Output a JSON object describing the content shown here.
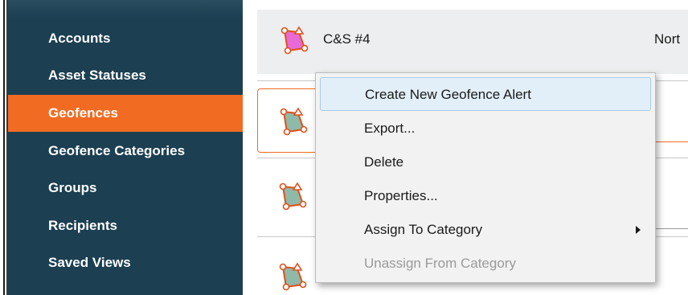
{
  "sidebar": {
    "items": [
      {
        "label": "Accounts",
        "active": false
      },
      {
        "label": "Asset Statuses",
        "active": false
      },
      {
        "label": "Geofences",
        "active": true
      },
      {
        "label": "Geofence Categories",
        "active": false
      },
      {
        "label": "Groups",
        "active": false
      },
      {
        "label": "Recipients",
        "active": false
      },
      {
        "label": "Saved Views",
        "active": false
      }
    ]
  },
  "list": {
    "top_row": {
      "name": "C&S #4",
      "region": "Nort",
      "icon": "geofence-polygon-pink-icon"
    },
    "rows": [
      {
        "icon": "geofence-polygon-green-icon",
        "selected": true
      },
      {
        "icon": "geofence-polygon-green-icon",
        "selected": false
      },
      {
        "icon": "geofence-polygon-green-icon",
        "selected": false
      }
    ]
  },
  "context_menu": {
    "items": [
      {
        "label": "Create New Geofence Alert",
        "state": "highlighted"
      },
      {
        "label": "Export...",
        "state": "normal"
      },
      {
        "label": "Delete",
        "state": "normal"
      },
      {
        "label": "Properties...",
        "state": "normal"
      },
      {
        "label": "Assign To Category",
        "state": "submenu"
      },
      {
        "label": "Unassign From Category",
        "state": "disabled"
      }
    ]
  },
  "colors": {
    "sidebar_bg": "#1c3f52",
    "accent": "#f16b22",
    "highlight": "#e3eff8",
    "pink_fill": "#e86ad6",
    "green_fill": "#8fb9a8"
  }
}
